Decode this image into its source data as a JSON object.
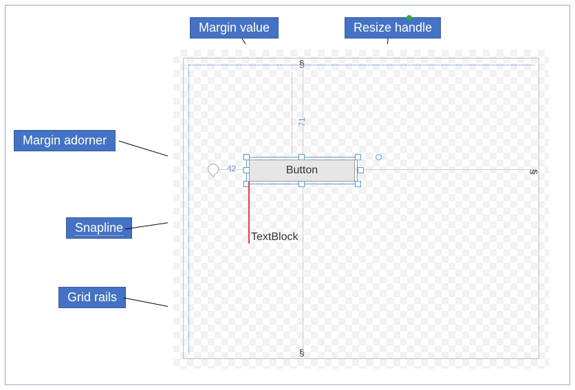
{
  "callouts": {
    "margin_value": "Margin value",
    "resize_handle": "Resize handle",
    "margin_adorner": "Margin adorner",
    "snapline": "Snapline",
    "grid_rails": "Grid rails"
  },
  "designer": {
    "button_label": "Button",
    "textblock_label": "TextBlock",
    "margin_top_value": "71",
    "margin_left_value": "42",
    "rail_glyph": "§"
  }
}
